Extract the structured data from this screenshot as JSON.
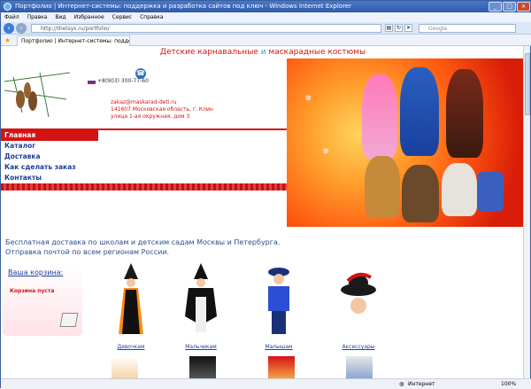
{
  "browser": {
    "title": "Портфолио | Интернет-системы: поддержка и разработка сайтов под ключ - Windows Internet Explorer",
    "menu": [
      "Файл",
      "Правка",
      "Вид",
      "Избранное",
      "Сервис",
      "Справка"
    ],
    "address": "http://thetsys.ru/portfolio/",
    "search_placeholder": "Google",
    "tab_label": "Портфолио | Интернет-системы: поддержка и разр...",
    "status_zone": "Интернет",
    "status_zoom": "100%"
  },
  "site": {
    "header": {
      "part1": "Детские карнавальные ",
      "part2": "и",
      "part3": " маскарадные костюмы"
    },
    "phone": "+8(903) 300-77-60",
    "contact": {
      "email": "zakaz@maskarad-deti.ru",
      "address1": "141607 Московская область, г. Клин",
      "address2": "улица 1-ая окружная, дом 3"
    },
    "nav": [
      "Главная",
      "Каталог",
      "Доставка",
      "Как сделать заказ",
      "Контакты"
    ],
    "promo": {
      "line1": "Бесплатная доставка по школам и детским садам Москвы и Петербурга.",
      "line2": "Отправка почтой по всем регионам России."
    },
    "cart": {
      "title": "Ваша корзина:",
      "empty": "Корзина пуста"
    },
    "categories": [
      "Девочкам",
      "Мальчикам",
      "Малышам",
      "Аксессуары"
    ]
  },
  "colors": {
    "accent_red": "#d31414",
    "link_blue": "#1c3f9a",
    "promo_blue": "#2a4f8f",
    "header_blue": "#2a9bd4"
  }
}
